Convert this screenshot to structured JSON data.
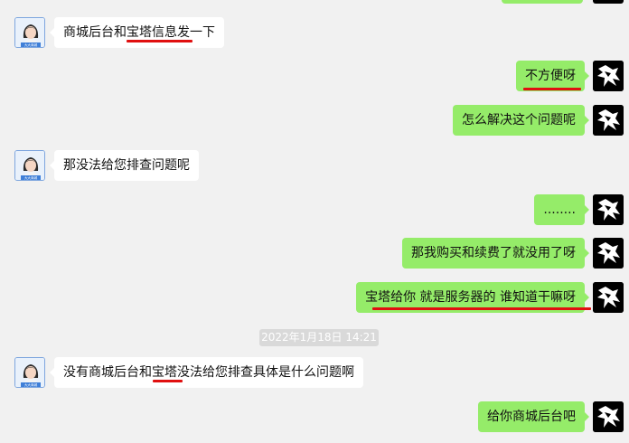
{
  "colors": {
    "background": "#f1f1f1",
    "incoming_bubble": "#ffffff",
    "outgoing_bubble": "#95ec69",
    "highlight_underline": "#e01010"
  },
  "avatars": {
    "contact_badge": "大大商城",
    "contact_icon": "girl-avatar-icon",
    "self_icon": "black-white-horse-avatar-icon"
  },
  "timestamp": "2022年1月18日 14:21",
  "messages": [
    {
      "side": "in",
      "text": "商城后台和宝塔信息发一下"
    },
    {
      "side": "out",
      "text": "不方便呀"
    },
    {
      "side": "out",
      "text": "怎么解决这个问题呢"
    },
    {
      "side": "in",
      "text": "那没法给您排查问题呢"
    },
    {
      "side": "out",
      "text": "........"
    },
    {
      "side": "out",
      "text": "那我购买和续费了就没用了呀"
    },
    {
      "side": "out",
      "text": "宝塔给你  就是服务器的  谁知道干嘛呀"
    },
    {
      "side": "in",
      "text": "没有商城后台和宝塔没法给您排查具体是什么问题啊"
    },
    {
      "side": "out",
      "text": "给你商城后台吧"
    }
  ]
}
